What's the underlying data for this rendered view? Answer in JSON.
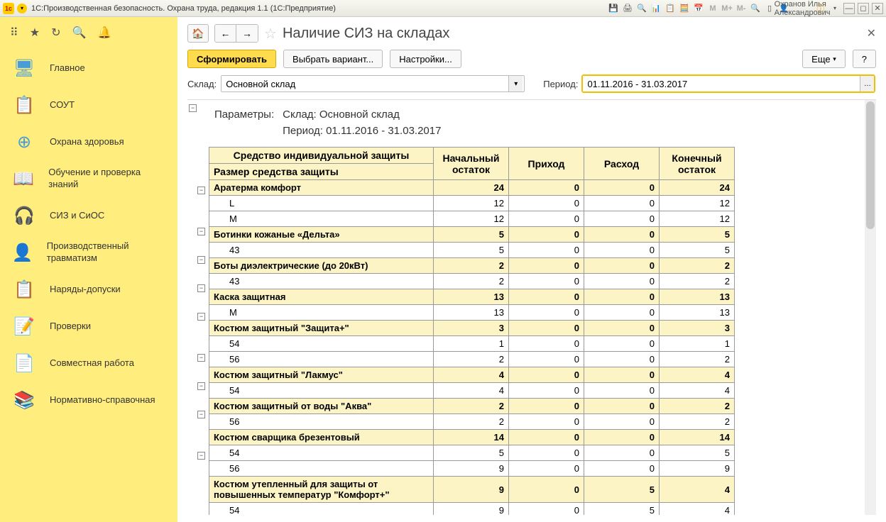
{
  "titlebar": {
    "app_title": "1С:Производственная безопасность. Охрана труда, редакция 1.1  (1С:Предприятие)",
    "user": "Охранов Илья Александрович",
    "icons": {
      "m": "M",
      "mplus": "M+",
      "mminus": "M-"
    }
  },
  "sidebar": {
    "items": [
      {
        "label": "Главное"
      },
      {
        "label": "СОУТ"
      },
      {
        "label": "Охрана здоровья"
      },
      {
        "label": "Обучение и проверка знаний"
      },
      {
        "label": "СИЗ и СиОС"
      },
      {
        "label": "Производственный травматизм"
      },
      {
        "label": "Наряды-допуски"
      },
      {
        "label": "Проверки"
      },
      {
        "label": "Совместная работа"
      },
      {
        "label": "Нормативно-справочная"
      }
    ]
  },
  "page": {
    "title": "Наличие СИЗ на складах",
    "buttons": {
      "generate": "Сформировать",
      "choose_variant": "Выбрать вариант...",
      "settings": "Настройки...",
      "more": "Еще",
      "help": "?"
    },
    "filter": {
      "warehouse_label": "Склад:",
      "warehouse_value": "Основной склад",
      "period_label": "Период:",
      "period_value": "01.11.2016 - 31.03.2017"
    }
  },
  "report": {
    "params_label": "Параметры:",
    "params_line1": "Склад: Основной склад",
    "params_line2": "Период: 01.11.2016 - 31.03.2017",
    "headers": {
      "item": "Средство индивидуальной защиты",
      "size": "Размер средства защиты",
      "start": "Начальный остаток",
      "in": "Приход",
      "out": "Расход",
      "end": "Конечный остаток"
    },
    "groups": [
      {
        "name": "Аратерма комфорт",
        "start": "24",
        "in": "0",
        "out": "0",
        "end": "24",
        "sizes": [
          {
            "size": "L",
            "start": "12",
            "in": "0",
            "out": "0",
            "end": "12"
          },
          {
            "size": "M",
            "start": "12",
            "in": "0",
            "out": "0",
            "end": "12"
          }
        ]
      },
      {
        "name": "Ботинки кожаные «Дельта»",
        "start": "5",
        "in": "0",
        "out": "0",
        "end": "5",
        "sizes": [
          {
            "size": "43",
            "start": "5",
            "in": "0",
            "out": "0",
            "end": "5"
          }
        ]
      },
      {
        "name": "Боты диэлектрические (до 20кВт)",
        "start": "2",
        "in": "0",
        "out": "0",
        "end": "2",
        "sizes": [
          {
            "size": "43",
            "start": "2",
            "in": "0",
            "out": "0",
            "end": "2"
          }
        ]
      },
      {
        "name": "Каска защитная",
        "start": "13",
        "in": "0",
        "out": "0",
        "end": "13",
        "sizes": [
          {
            "size": "M",
            "start": "13",
            "in": "0",
            "out": "0",
            "end": "13"
          }
        ]
      },
      {
        "name": "Костюм защитный \"Защита+\"",
        "start": "3",
        "in": "0",
        "out": "0",
        "end": "3",
        "sizes": [
          {
            "size": "54",
            "start": "1",
            "in": "0",
            "out": "0",
            "end": "1"
          },
          {
            "size": "56",
            "start": "2",
            "in": "0",
            "out": "0",
            "end": "2"
          }
        ]
      },
      {
        "name": "Костюм защитный \"Лакмус\"",
        "start": "4",
        "in": "0",
        "out": "0",
        "end": "4",
        "sizes": [
          {
            "size": "54",
            "start": "4",
            "in": "0",
            "out": "0",
            "end": "4"
          }
        ]
      },
      {
        "name": "Костюм защитный от воды \"Аква\"",
        "start": "2",
        "in": "0",
        "out": "0",
        "end": "2",
        "sizes": [
          {
            "size": "56",
            "start": "2",
            "in": "0",
            "out": "0",
            "end": "2"
          }
        ]
      },
      {
        "name": "Костюм сварщика брезентовый",
        "start": "14",
        "in": "0",
        "out": "0",
        "end": "14",
        "sizes": [
          {
            "size": "54",
            "start": "5",
            "in": "0",
            "out": "0",
            "end": "5"
          },
          {
            "size": "56",
            "start": "9",
            "in": "0",
            "out": "0",
            "end": "9"
          }
        ]
      },
      {
        "name": "Костюм утепленный для защиты от повышенных температур \"Комфорт+\"",
        "start": "9",
        "in": "0",
        "out": "5",
        "end": "4",
        "sizes": [
          {
            "size": "54",
            "start": "9",
            "in": "0",
            "out": "5",
            "end": "4"
          }
        ]
      }
    ]
  }
}
